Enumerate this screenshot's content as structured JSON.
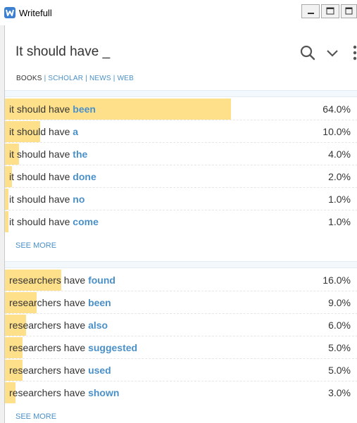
{
  "window": {
    "title": "Writefull",
    "minimize_icon": "minimize-icon",
    "restore_icon": "restore-icon",
    "close_icon": "close-icon"
  },
  "search": {
    "query": "It should have _",
    "search_icon": "search-icon",
    "collapse_icon": "chevron-down-icon",
    "menu_icon": "more-vertical-icon"
  },
  "sources": [
    {
      "label": "BOOKS",
      "active": true
    },
    {
      "label": "SCHOLAR",
      "active": false
    },
    {
      "label": "NEWS",
      "active": false
    },
    {
      "label": "WEB",
      "active": false
    }
  ],
  "colors": {
    "bar": "#ffe08a",
    "link": "#4a90c8",
    "text": "#333333"
  },
  "groups": [
    {
      "see_more": "SEE MORE",
      "results": [
        {
          "prefix": "it should have ",
          "word": "been",
          "percent": "64.0%",
          "value": 64.0
        },
        {
          "prefix": "it should have ",
          "word": "a",
          "percent": "10.0%",
          "value": 10.0
        },
        {
          "prefix": "it should have ",
          "word": "the",
          "percent": "4.0%",
          "value": 4.0
        },
        {
          "prefix": "it should have ",
          "word": "done",
          "percent": "2.0%",
          "value": 2.0
        },
        {
          "prefix": "it should have ",
          "word": "no",
          "percent": "1.0%",
          "value": 1.0
        },
        {
          "prefix": "it should have ",
          "word": "come",
          "percent": "1.0%",
          "value": 1.0
        }
      ]
    },
    {
      "see_more": "SEE MORE",
      "results": [
        {
          "prefix": "researchers have ",
          "word": "found",
          "percent": "16.0%",
          "value": 16.0
        },
        {
          "prefix": "researchers have ",
          "word": "been",
          "percent": "9.0%",
          "value": 9.0
        },
        {
          "prefix": "researchers have ",
          "word": "also",
          "percent": "6.0%",
          "value": 6.0
        },
        {
          "prefix": "researchers have ",
          "word": "suggested",
          "percent": "5.0%",
          "value": 5.0
        },
        {
          "prefix": "researchers have ",
          "word": "used",
          "percent": "5.0%",
          "value": 5.0
        },
        {
          "prefix": "researchers have ",
          "word": "shown",
          "percent": "3.0%",
          "value": 3.0
        }
      ]
    }
  ]
}
